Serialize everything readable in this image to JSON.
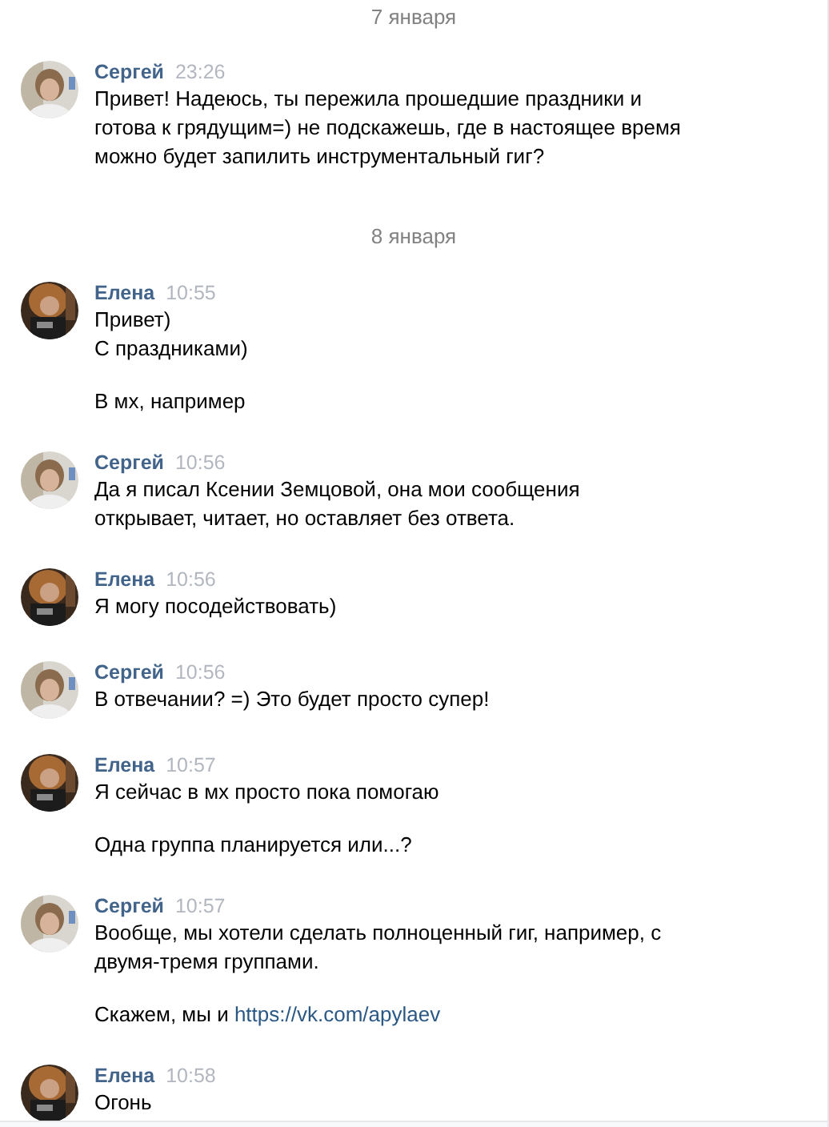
{
  "items": [
    {
      "kind": "date",
      "text": "7 января"
    },
    {
      "kind": "message",
      "author": "Сергей",
      "avatar": {
        "kind": "light"
      },
      "time": "23:26",
      "paragraphs": [
        {
          "text": "Привет! Надеюсь, ты пережила прошедшие праздники и готова к грядущим=) не подскажешь, где в настоящее время можно будет запилить инструментальный гиг?"
        }
      ]
    },
    {
      "kind": "date",
      "text": "8 января"
    },
    {
      "kind": "message",
      "author": "Елена",
      "avatar": {
        "kind": "dark"
      },
      "time": "10:55",
      "paragraphs": [
        {
          "text": "Привет)"
        },
        {
          "text": "С праздниками)",
          "tight": true
        },
        {
          "text": "В мх, например"
        }
      ]
    },
    {
      "kind": "message",
      "author": "Сергей",
      "avatar": {
        "kind": "light"
      },
      "time": "10:56",
      "paragraphs": [
        {
          "text": "Да я писал Ксении Земцовой, она мои сообщения открывает, читает, но оставляет без ответа."
        }
      ]
    },
    {
      "kind": "message",
      "author": "Елена",
      "avatar": {
        "kind": "dark"
      },
      "time": "10:56",
      "paragraphs": [
        {
          "text": "Я могу посодействовать)"
        }
      ]
    },
    {
      "kind": "message",
      "author": "Сергей",
      "avatar": {
        "kind": "light"
      },
      "time": "10:56",
      "paragraphs": [
        {
          "text": "В отвечании? =) Это будет просто супер!"
        }
      ]
    },
    {
      "kind": "message",
      "author": "Елена",
      "avatar": {
        "kind": "dark"
      },
      "time": "10:57",
      "paragraphs": [
        {
          "text": "Я сейчас в мх просто пока помогаю"
        },
        {
          "text": "Одна группа планируется или...?"
        }
      ]
    },
    {
      "kind": "message",
      "author": "Сергей",
      "avatar": {
        "kind": "light"
      },
      "time": "10:57",
      "paragraphs": [
        {
          "text": "Вообще, мы хотели сделать полноценный гиг, например, с двумя-тремя группами."
        },
        {
          "text": "Скажем, мы и ",
          "link": "https://vk.com/apylaev"
        }
      ]
    },
    {
      "kind": "message",
      "author": "Елена",
      "avatar": {
        "kind": "dark"
      },
      "time": "10:58",
      "paragraphs": [
        {
          "text": "Огонь"
        }
      ]
    }
  ]
}
